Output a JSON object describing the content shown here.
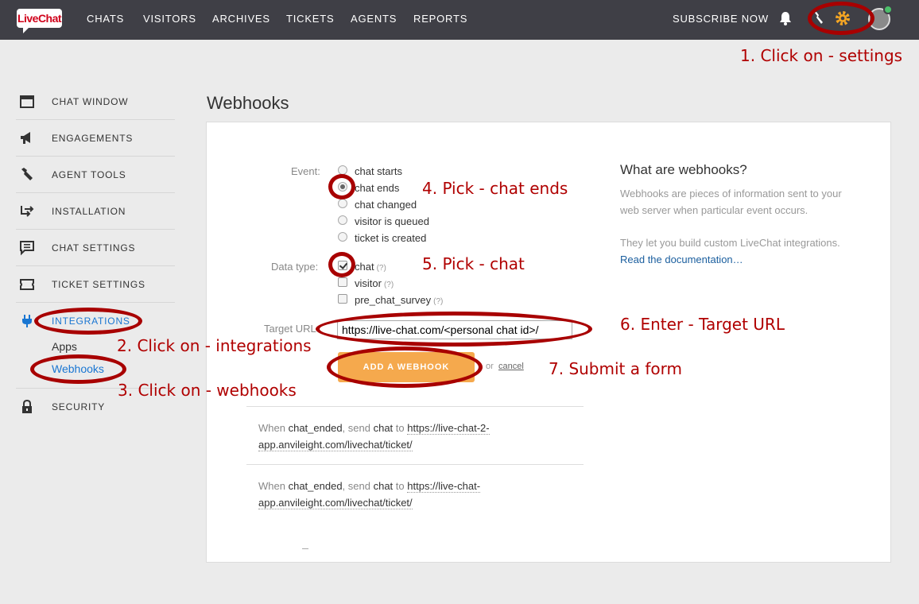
{
  "header": {
    "logo_text": "LiveChat",
    "nav": [
      "CHATS",
      "VISITORS",
      "ARCHIVES",
      "TICKETS",
      "AGENTS",
      "REPORTS"
    ],
    "subscribe_label": "SUBSCRIBE NOW"
  },
  "sidebar": {
    "items": [
      {
        "label": "CHAT WINDOW",
        "icon": "window-icon"
      },
      {
        "label": "ENGAGEMENTS",
        "icon": "megaphone-icon"
      },
      {
        "label": "AGENT TOOLS",
        "icon": "wrench-icon"
      },
      {
        "label": "INSTALLATION",
        "icon": "arrows-icon"
      },
      {
        "label": "CHAT SETTINGS",
        "icon": "message-icon"
      },
      {
        "label": "TICKET SETTINGS",
        "icon": "ticket-icon"
      },
      {
        "label": "INTEGRATIONS",
        "icon": "plug-icon"
      },
      {
        "label": "SECURITY",
        "icon": "lock-icon"
      }
    ],
    "sub_items": [
      "Apps",
      "Webhooks"
    ]
  },
  "page": {
    "title": "Webhooks"
  },
  "form": {
    "event_label": "Event:",
    "events": [
      "chat starts",
      "chat ends",
      "chat changed",
      "visitor is queued",
      "ticket is created"
    ],
    "selected_event": "chat ends",
    "data_type_label": "Data type:",
    "data_types": [
      "chat",
      "visitor",
      "pre_chat_survey"
    ],
    "help_mark": "(?)",
    "target_url_label": "Target URL",
    "target_url_value": "https://live-chat.com/<personal chat id>/",
    "submit_label": "ADD A WEBHOOK",
    "or_label": "or",
    "cancel_label": "cancel"
  },
  "webhooks": [
    {
      "when": "When",
      "event": "chat_ended",
      "send": ", send",
      "data": "chat",
      "to": "to",
      "url": "https://live-chat-2-app.anvileight.com/livechat/ticket/"
    },
    {
      "when": "When",
      "event": "chat_ended",
      "send": ", send",
      "data": "chat",
      "to": "to",
      "url": "https://live-chat-app.anvileight.com/livechat/ticket/"
    }
  ],
  "info": {
    "title": "What are webhooks?",
    "p1": "Webhooks are pieces of information sent to your web server when particular event occurs.",
    "p2": "They let you build custom LiveChat integrations.",
    "link": "Read the documentation…"
  },
  "annotations": {
    "a1": "1. Click on - settings",
    "a2": "2. Click on - integrations",
    "a3": "3. Click on - webhooks",
    "a4": "4. Pick - chat ends",
    "a5": "5. Pick - chat",
    "a6": "6. Enter - Target URL",
    "a7": "7. Submit a form"
  },
  "colors": {
    "topbar": "#3f3f46",
    "accent_blue": "#1976d2",
    "button_orange": "#f5a94d",
    "annotation_red": "#a80000"
  }
}
